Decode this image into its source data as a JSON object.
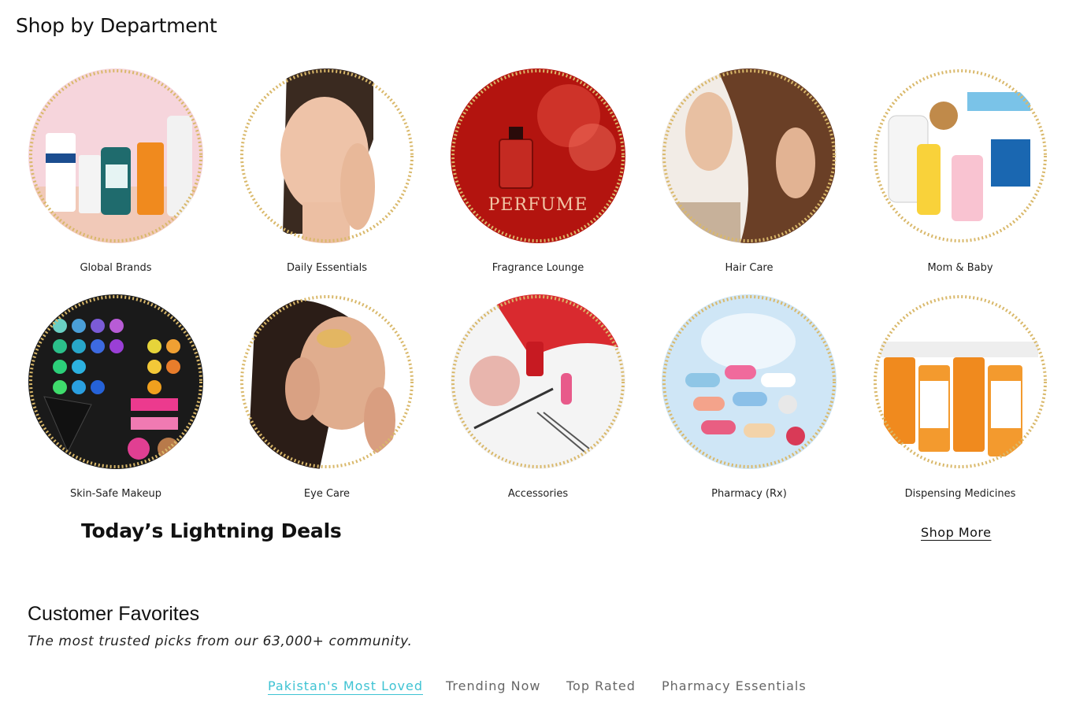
{
  "shop_by_department": {
    "title": "Shop by Department",
    "items": [
      {
        "label": "Global Brands"
      },
      {
        "label": "Daily Essentials"
      },
      {
        "label": "Fragrance Lounge",
        "image_text": "PERFUME"
      },
      {
        "label": "Hair Care"
      },
      {
        "label": "Mom & Baby"
      },
      {
        "label": "Skin-Safe Makeup"
      },
      {
        "label": "Eye Care"
      },
      {
        "label": "Accessories"
      },
      {
        "label": "Pharmacy (Rx)"
      },
      {
        "label": "Dispensing Medicines"
      }
    ]
  },
  "lightning_deals": {
    "title": "Today’s Lightning Deals",
    "shop_more": "Shop More"
  },
  "customer_favorites": {
    "title": "Customer Favorites",
    "subtitle": "The most trusted picks from our 63,000+ community.",
    "tabs": [
      {
        "label": "Pakistan's Most Loved",
        "active": true
      },
      {
        "label": "Trending Now",
        "active": false
      },
      {
        "label": "Top Rated",
        "active": false
      },
      {
        "label": "Pharmacy Essentials",
        "active": false
      }
    ]
  },
  "colors": {
    "accent_tab": "#3fc3d3",
    "glitter_border": "#d9b86a",
    "perfume_red": "#b3140f"
  }
}
